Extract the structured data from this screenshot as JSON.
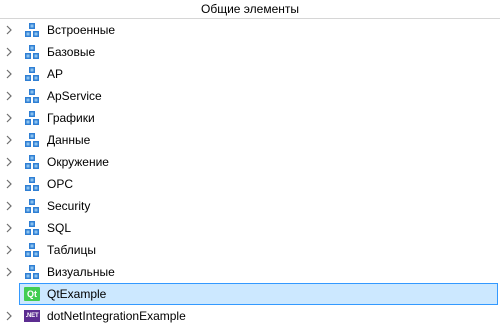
{
  "header": {
    "title": "Общие элементы"
  },
  "tree": {
    "items": [
      {
        "label": "Встроенные",
        "icon": "package-cubes-icon"
      },
      {
        "label": "Базовые",
        "icon": "package-cubes-icon"
      },
      {
        "label": "AP",
        "icon": "package-cubes-icon"
      },
      {
        "label": "ApService",
        "icon": "package-cubes-icon"
      },
      {
        "label": "Графики",
        "icon": "package-cubes-icon"
      },
      {
        "label": "Данные",
        "icon": "package-cubes-icon"
      },
      {
        "label": "Окружение",
        "icon": "package-cubes-icon"
      },
      {
        "label": "OPC",
        "icon": "package-cubes-icon"
      },
      {
        "label": "Security",
        "icon": "package-cubes-icon"
      },
      {
        "label": "SQL",
        "icon": "package-cubes-icon"
      },
      {
        "label": "Таблицы",
        "icon": "package-cubes-icon"
      },
      {
        "label": "Визуальные",
        "icon": "package-cubes-icon"
      },
      {
        "label": "QtExample",
        "icon": "qt-logo-icon",
        "icon_text": "Qt",
        "selected": true
      },
      {
        "label": "dotNetIntegrationExample",
        "icon": "dotnet-logo-icon",
        "icon_text": ".NET"
      }
    ]
  },
  "colors": {
    "selection_bg": "#cce8ff",
    "selection_border": "#3399ff",
    "cube_blue": "#2f7fd4",
    "cube_light": "#8cc3ef",
    "qt_green": "#41cd52",
    "dotnet_purple": "#5c2d91"
  }
}
